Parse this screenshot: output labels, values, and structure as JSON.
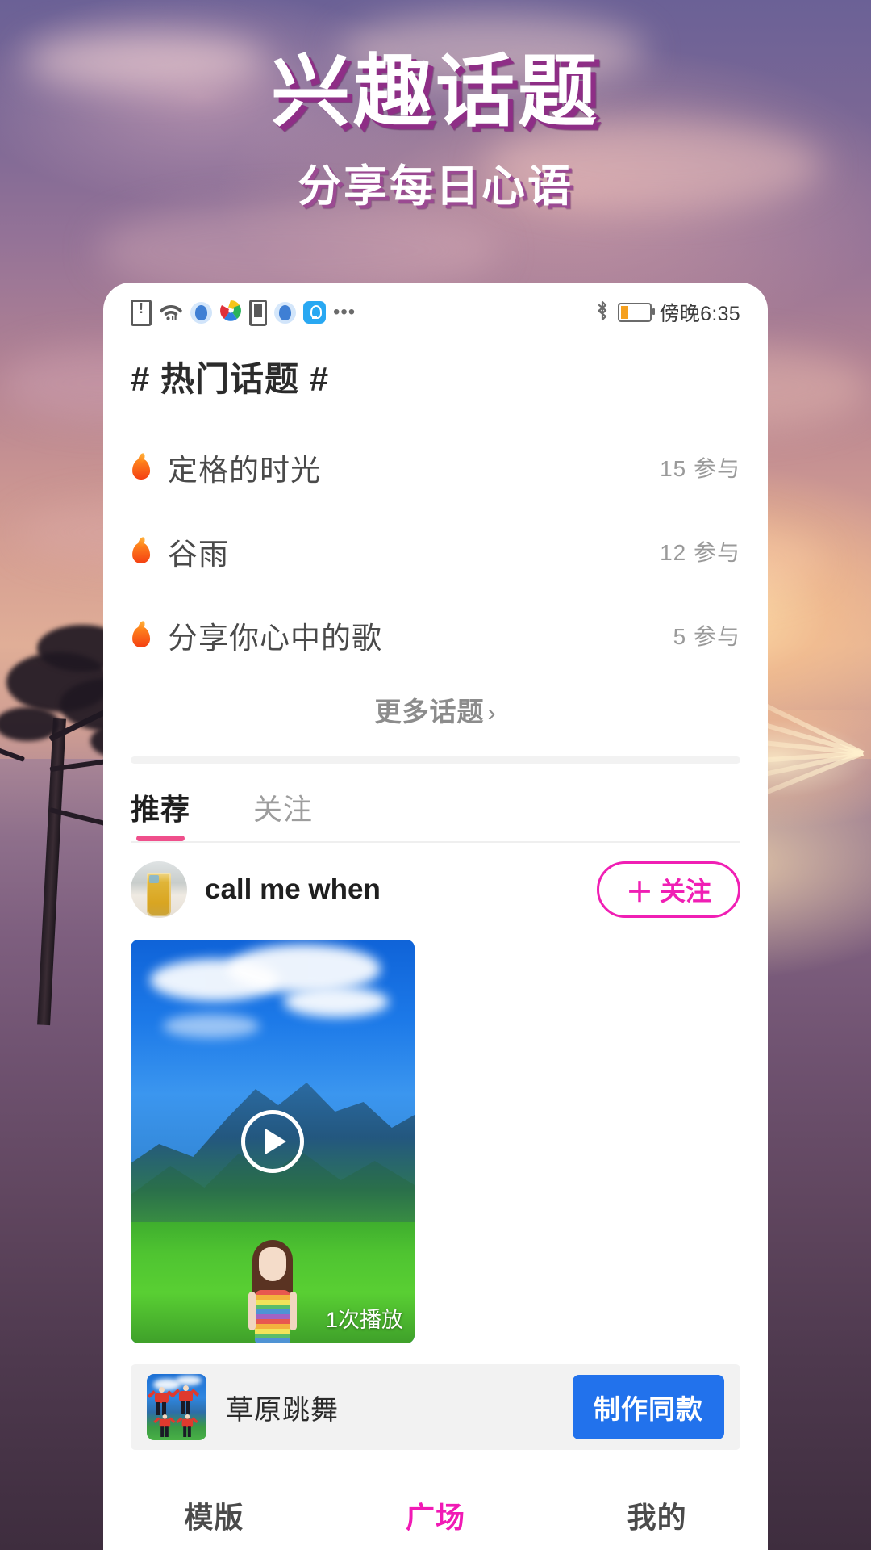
{
  "hero": {
    "title": "兴趣话题",
    "subtitle": "分享每日心语",
    "title_color": "#ffffff",
    "title_shadow_color": "#8e2e86"
  },
  "status_bar": {
    "time": "傍晚6:35",
    "left_icons": [
      "sim-alert-icon",
      "wifi-icon",
      "app-blue-icon",
      "colorwheel-icon",
      "battery-small-icon",
      "app-blue-icon",
      "lightbulb-icon",
      "more-dots-icon"
    ],
    "right_icons": [
      "bluetooth-icon",
      "battery-low-icon"
    ]
  },
  "hot_topics": {
    "heading": "# 热门话题 #",
    "items": [
      {
        "name": "定格的时光",
        "count": "15 参与"
      },
      {
        "name": "谷雨",
        "count": "12 参与"
      },
      {
        "name": "分享你心中的歌",
        "count": "5 参与"
      }
    ],
    "more_label": "更多话题",
    "more_chevron": "›"
  },
  "feed_tabs": {
    "items": [
      {
        "label": "推荐",
        "active": true
      },
      {
        "label": "关注",
        "active": false
      }
    ],
    "indicator_color": "#ef4f8b"
  },
  "post": {
    "username": "call me when",
    "avatar_name": "iced-drink-avatar",
    "follow_button": {
      "plus": "＋",
      "label": "关注",
      "color": "#f01fb4"
    },
    "video": {
      "play_count": "1次播放",
      "play_icon": "play-icon"
    },
    "music": {
      "title": "草原跳舞",
      "button_label": "制作同款",
      "button_color": "#2272ec"
    }
  },
  "bottom_nav": {
    "items": [
      {
        "label": "模版",
        "active": false
      },
      {
        "label": "广场",
        "active": true
      },
      {
        "label": "我的",
        "active": false
      }
    ],
    "active_color": "#f11ab5"
  }
}
